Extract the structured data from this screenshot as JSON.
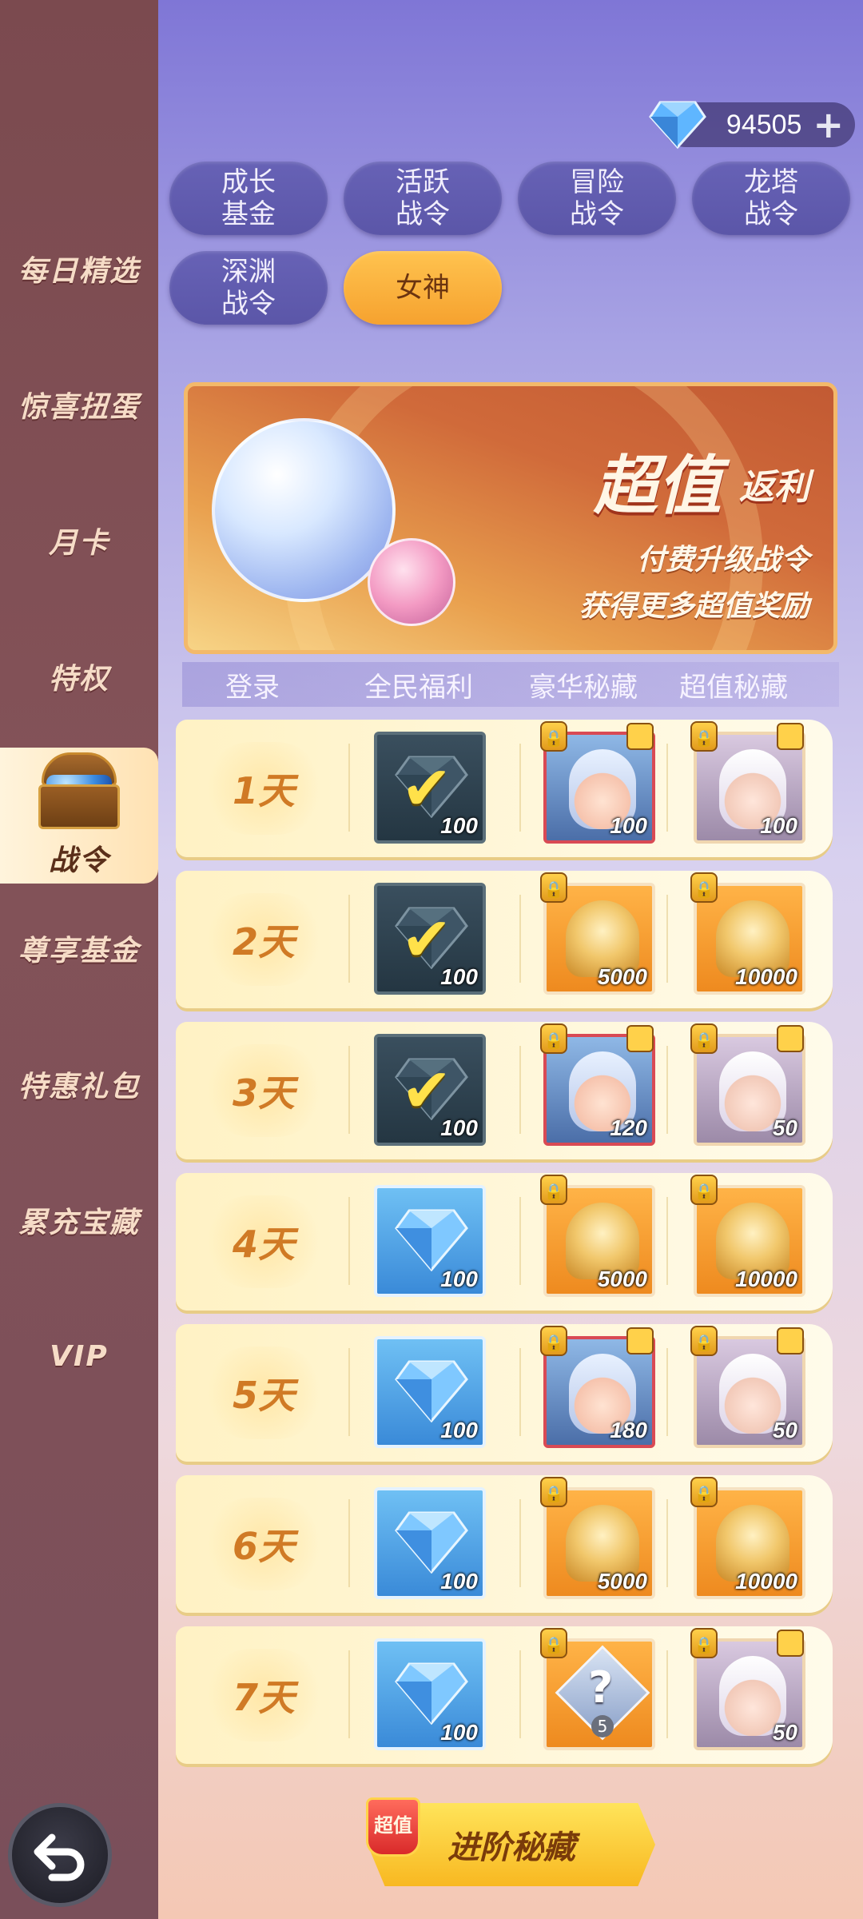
{
  "sidebar": {
    "items": [
      {
        "label": "每日精选"
      },
      {
        "label": "惊喜扭蛋"
      },
      {
        "label": "月卡"
      },
      {
        "label": "特权"
      },
      {
        "label": "战令",
        "active": true
      },
      {
        "label": "尊享基金"
      },
      {
        "label": "特惠礼包"
      },
      {
        "label": "累充宝藏"
      },
      {
        "label": "VIP"
      }
    ],
    "back_icon": "back-arrow-icon"
  },
  "currency": {
    "icon": "diamond-icon",
    "amount": "94505",
    "add": "+"
  },
  "tabs": [
    {
      "label": "成长\n基金"
    },
    {
      "label": "活跃\n战令"
    },
    {
      "label": "冒险\n战令"
    },
    {
      "label": "龙塔\n战令"
    },
    {
      "label": "深渊\n战令"
    },
    {
      "label": "女神",
      "active": true
    }
  ],
  "banner": {
    "title_big": "超值",
    "title_small": "返利",
    "line1": "付费升级战令",
    "line2": "获得更多超值奖励"
  },
  "table": {
    "headers": [
      "登录",
      "全民福利",
      "豪华秘藏",
      "超值秘藏"
    ],
    "rows": [
      {
        "day": "1天",
        "free": {
          "kind": "gem-claimed",
          "qty": "100"
        },
        "luxury": {
          "kind": "hero-blue",
          "qty": "100"
        },
        "super": {
          "kind": "hero-white",
          "qty": "100"
        }
      },
      {
        "day": "2天",
        "free": {
          "kind": "gem-claimed",
          "qty": "100"
        },
        "luxury": {
          "kind": "wings",
          "qty": "5000"
        },
        "super": {
          "kind": "wings",
          "qty": "10000"
        }
      },
      {
        "day": "3天",
        "free": {
          "kind": "gem-claimed",
          "qty": "100"
        },
        "luxury": {
          "kind": "hero-blue",
          "qty": "120"
        },
        "super": {
          "kind": "hero-white",
          "qty": "50"
        }
      },
      {
        "day": "4天",
        "free": {
          "kind": "gem",
          "qty": "100"
        },
        "luxury": {
          "kind": "wings",
          "qty": "5000"
        },
        "super": {
          "kind": "wings",
          "qty": "10000"
        }
      },
      {
        "day": "5天",
        "free": {
          "kind": "gem",
          "qty": "100"
        },
        "luxury": {
          "kind": "hero-blue",
          "qty": "180"
        },
        "super": {
          "kind": "hero-white",
          "qty": "50"
        }
      },
      {
        "day": "6天",
        "free": {
          "kind": "gem",
          "qty": "100"
        },
        "luxury": {
          "kind": "wings",
          "qty": "5000"
        },
        "super": {
          "kind": "wings",
          "qty": "10000"
        }
      },
      {
        "day": "7天",
        "free": {
          "kind": "gem",
          "qty": "100"
        },
        "luxury": {
          "kind": "mystery",
          "qty": "",
          "mark": "5"
        },
        "super": {
          "kind": "hero-white",
          "qty": "50"
        }
      }
    ]
  },
  "advance_button": {
    "badge": "超值",
    "label": "进阶秘藏"
  },
  "colors": {
    "sidebar": "#7b4a4f",
    "tab_active": "#f6a22f",
    "tab": "#5b56a8",
    "day_text": "#d07a25"
  }
}
